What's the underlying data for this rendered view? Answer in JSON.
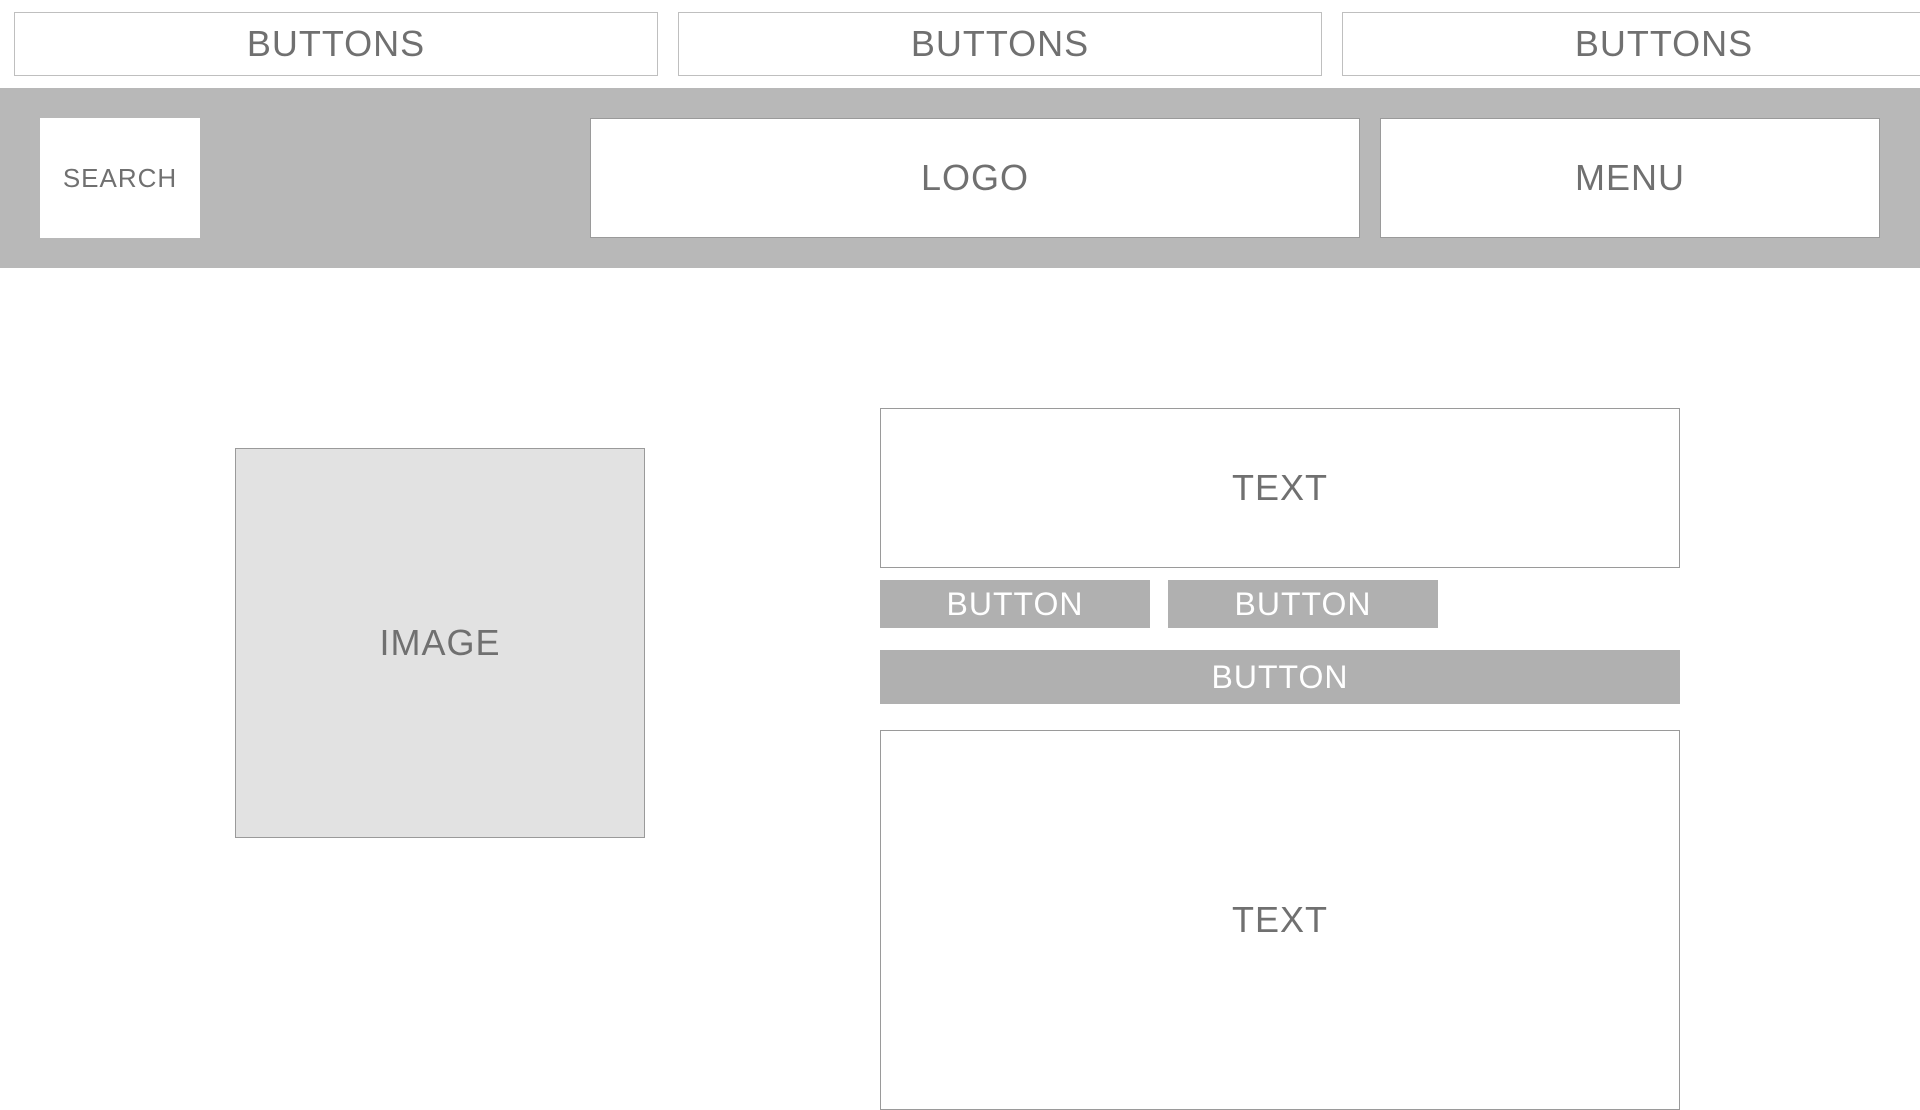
{
  "topButtons": {
    "button1": "BUTTONS",
    "button2": "BUTTONS",
    "button3": "BUTTONS"
  },
  "header": {
    "search": "SEARCH",
    "logo": "LOGO",
    "menu": "MENU"
  },
  "content": {
    "image": "IMAGE",
    "text1": "TEXT",
    "button1": "BUTTON",
    "button2": "BUTTON",
    "button3": "BUTTON",
    "text2": "TEXT"
  }
}
